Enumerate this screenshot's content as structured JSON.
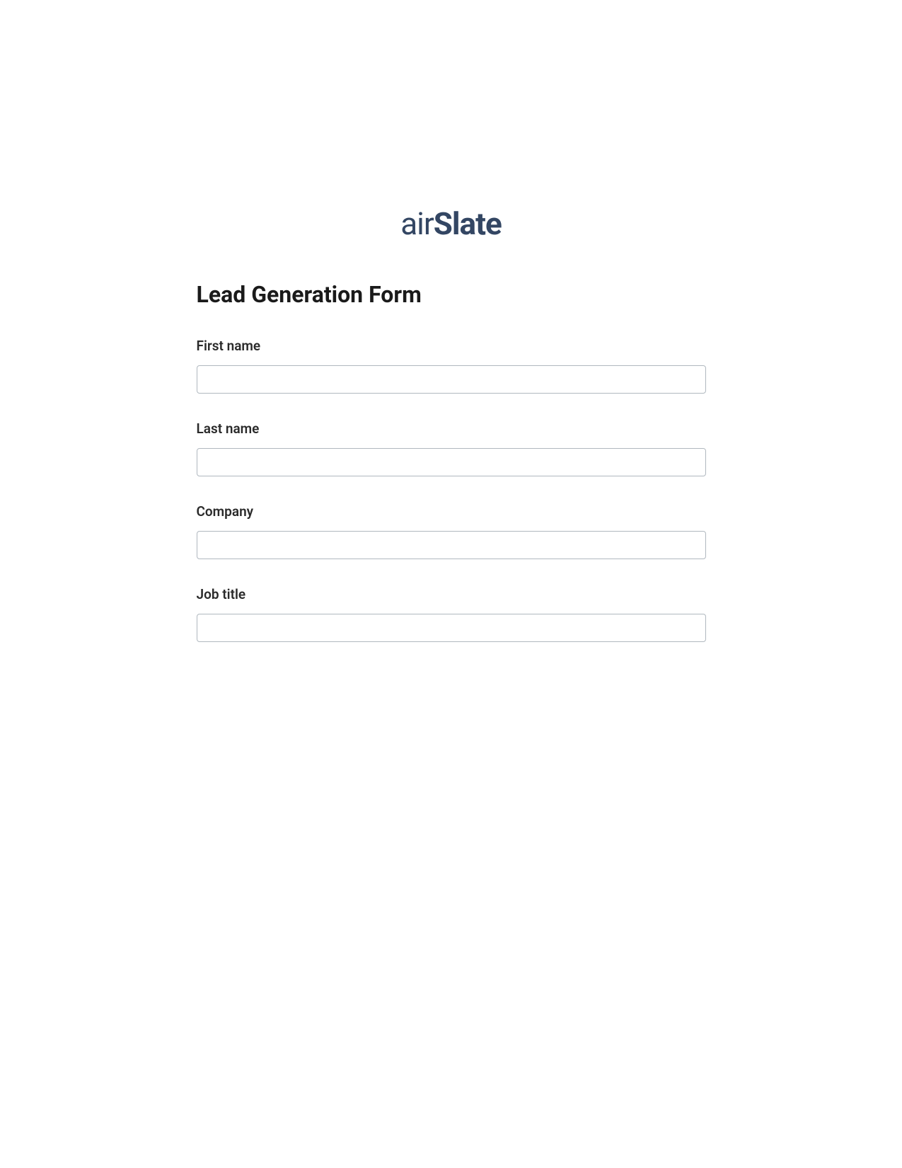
{
  "logo": {
    "part1": "air",
    "part2": "Slate"
  },
  "form": {
    "title": "Lead Generation Form",
    "fields": [
      {
        "label": "First name",
        "value": ""
      },
      {
        "label": "Last name",
        "value": ""
      },
      {
        "label": "Company",
        "value": ""
      },
      {
        "label": "Job title",
        "value": ""
      }
    ]
  }
}
